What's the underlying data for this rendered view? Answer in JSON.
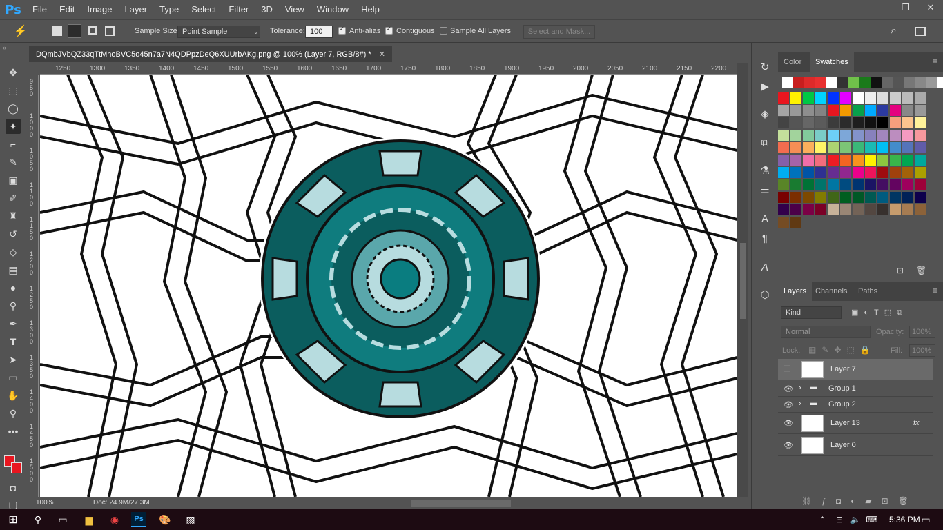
{
  "app": {
    "logo": "Ps",
    "menu": [
      "File",
      "Edit",
      "Image",
      "Layer",
      "Type",
      "Select",
      "Filter",
      "3D",
      "View",
      "Window",
      "Help"
    ]
  },
  "window_controls": [
    "—",
    "❐",
    "✕"
  ],
  "options": {
    "sample_size_label": "Sample Size:",
    "sample_size_value": "Point Sample",
    "tolerance_label": "Tolerance:",
    "tolerance_value": "100",
    "antialias_label": "Anti-alias",
    "antialias": true,
    "contiguous_label": "Contiguous",
    "contiguous": true,
    "sample_all_label": "Sample All Layers",
    "sample_all": false,
    "select_mask": "Select and Mask..."
  },
  "document": {
    "tab_title": "DQmbJVbQZ33qTtMhoBVC5o45n7a7N4QDPpzDeQ6XUUrbAKg.png @ 100% (Layer 7, RGB/8#) *",
    "close": "✕"
  },
  "ruler_h": [
    "1250",
    "1300",
    "1350",
    "1400",
    "1450",
    "1500",
    "1550",
    "1600",
    "1650",
    "1700",
    "1750",
    "1800",
    "1850",
    "1900",
    "1950",
    "2000",
    "2050",
    "2100",
    "2150",
    "2200"
  ],
  "ruler_v": [
    "9 5 0",
    "1 0 0 0",
    "1 0 5 0",
    "1 1 0 0",
    "1 1 5 0",
    "1 2 0 0",
    "1 2 5 0",
    "1 3 0 0",
    "1 3 5 0",
    "1 4 0 0",
    "1 4 5 0",
    "1 5 0 0"
  ],
  "status": {
    "zoom": "100%",
    "doc": "Doc: 24.9M/27.3M"
  },
  "panels": {
    "color_tab": "Color",
    "swatches_tab": "Swatches",
    "layers_tab": "Layers",
    "channels_tab": "Channels",
    "paths_tab": "Paths",
    "kind": "Kind",
    "blend": "Normal",
    "opacity_label": "Opacity:",
    "opacity": "100%",
    "lock_label": "Lock:",
    "fill_label": "Fill:",
    "fill": "100%"
  },
  "layers": [
    {
      "name": "Layer 7",
      "visible": false,
      "selected": true,
      "type": "layer"
    },
    {
      "name": "Group 1",
      "visible": true,
      "selected": false,
      "type": "group"
    },
    {
      "name": "Group 2",
      "visible": true,
      "selected": false,
      "type": "group"
    },
    {
      "name": "Layer 13",
      "visible": true,
      "selected": false,
      "type": "layer",
      "fx": "fx"
    },
    {
      "name": "Layer 0",
      "visible": true,
      "selected": false,
      "type": "layer"
    }
  ],
  "swatches_top": [
    "#ffffff",
    "#c81e1e",
    "#dd2a2a",
    "#e83030",
    "#ffffff",
    "#333333",
    "#70c14a",
    "#1a7a1a",
    "#111111",
    "#666666",
    "#555555",
    "#777777",
    "#888888",
    "#999999",
    "#ffffff"
  ],
  "swatches": [
    [
      "#e8161f",
      "#fff200",
      "#00c845",
      "#00d3ff",
      "#0033ff",
      "#e300ff",
      "#ffffff",
      "#eeeeee",
      "#dddddd",
      "#cccccc",
      "#bbbbbb",
      "#aaaaaa"
    ],
    [
      "#a4a4a4",
      "#999999",
      "#8e8e8e",
      "#838383",
      "#e8161f",
      "#f39a00",
      "#08a04b",
      "#00aaff",
      "#2c3aa0",
      "#e4007f",
      "#888888",
      "#999999"
    ],
    [
      "#444444",
      "#555555",
      "#666666",
      "#5b5b5b",
      "#3c3c3c",
      "#2b2b2b",
      "#1e1e1e",
      "#111111",
      "#000000",
      "#f59f7d",
      "#fbc58e",
      "#fff29a"
    ],
    [
      "#c4df9b",
      "#a2d39c",
      "#82ca9c",
      "#7accc8",
      "#6dcff6",
      "#7da7d8",
      "#8393ca",
      "#8781bd",
      "#a186be",
      "#bc8dbf",
      "#f49ac1",
      "#f6989d"
    ],
    [
      "#f26c4f",
      "#f68e55",
      "#fbaf5c",
      "#fff467",
      "#acd372",
      "#7cc576",
      "#3bb878",
      "#1abbb4",
      "#00bff3",
      "#438ccb",
      "#5574b9",
      "#605ca8"
    ],
    [
      "#8560a8",
      "#a763a8",
      "#f06ea9",
      "#f26d7d",
      "#ed1c24",
      "#f26522",
      "#f7941d",
      "#fff200",
      "#8dc73f",
      "#39b54a",
      "#00a651",
      "#00a99d"
    ],
    [
      "#00aeef",
      "#0072bc",
      "#0054a6",
      "#2e3192",
      "#662d91",
      "#92278f",
      "#ec008c",
      "#ed145b",
      "#9e0b0f",
      "#a0410d",
      "#a3620a",
      "#aba000"
    ],
    [
      "#598527",
      "#197b30",
      "#007236",
      "#00746b",
      "#0076a3",
      "#004b80",
      "#003471",
      "#1b1464",
      "#440e62",
      "#630460",
      "#9e005d",
      "#9e0039"
    ],
    [
      "#790000",
      "#7b2e00",
      "#7d4900",
      "#827b00",
      "#406618",
      "#005e20",
      "#005826",
      "#005952",
      "#005b7f",
      "#003663",
      "#002157",
      "#0d004c"
    ],
    [
      "#32004b",
      "#4b0049",
      "#7b0046",
      "#7a0026",
      "#c7b299",
      "#998675",
      "#736357",
      "#534741",
      "#37302d",
      "#c69c6d",
      "#a67c52",
      "#8c6239"
    ],
    [
      "#754c24",
      "#603913"
    ]
  ]
}
